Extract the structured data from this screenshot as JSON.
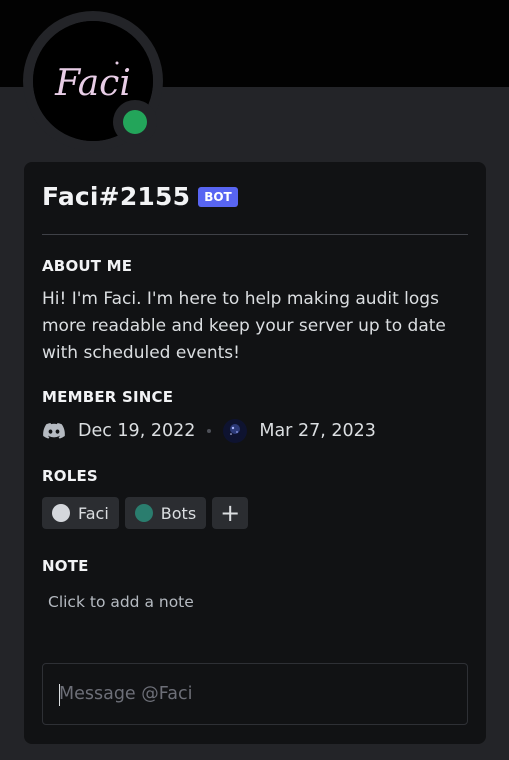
{
  "profile": {
    "avatar_text": "Faci",
    "username": "Faci#2155",
    "bot_tag": "BOT",
    "status_color": "#23a55a"
  },
  "about": {
    "title": "ABOUT ME",
    "text": "Hi! I'm Faci. I'm here to help making audit logs more readable and keep your server up to date with scheduled events!"
  },
  "member_since": {
    "title": "MEMBER SINCE",
    "discord_date": "Dec 19, 2022",
    "server_date": "Mar 27, 2023"
  },
  "roles": {
    "title": "ROLES",
    "items": [
      {
        "label": "Faci",
        "color": "#d4d7dc"
      },
      {
        "label": "Bots",
        "color": "#2a7d6e"
      }
    ],
    "add_label": "+"
  },
  "note": {
    "title": "NOTE",
    "placeholder": "Click to add a note"
  },
  "message": {
    "placeholder": "Message @Faci"
  },
  "colors": {
    "accent": "#5865f2",
    "background": "#232428",
    "card": "#111214"
  }
}
